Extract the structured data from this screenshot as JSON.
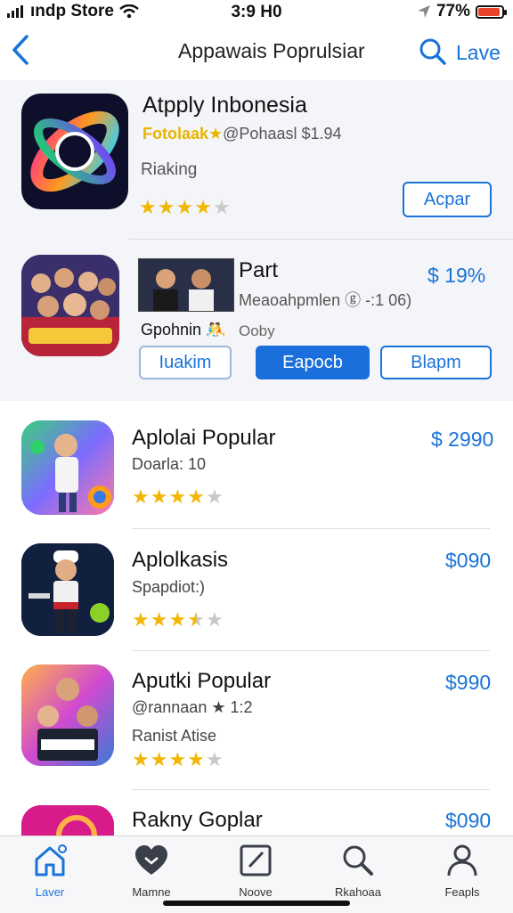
{
  "status_bar": {
    "carrier": "ındp Store",
    "time": "3:9 H0",
    "battery": "77%"
  },
  "nav": {
    "title": "Appawais  Poprulsiar",
    "action": "Lave"
  },
  "featured": [
    {
      "title": "Atpply Inbonesia",
      "subtitle_gold": "Fotolaak★",
      "subtitle": "@Pohaasl  $1.94",
      "rank_label": "Riaking",
      "rating": 4,
      "button": "Acpar"
    },
    {
      "title": "Part",
      "subtitle": "Meaoahpmlen ⓖ -:1 06)",
      "price": "$ 19%",
      "tag": "Gpohnin 🤼",
      "tag2": "Ooby",
      "buttons": [
        "Iuakim",
        "Eapocb",
        "Blapm"
      ]
    }
  ],
  "list": [
    {
      "title": "Aplolai Popular",
      "subtitle": "Doarla: 10",
      "price": "$ 2990",
      "rating": 4
    },
    {
      "title": "Aplolkasis",
      "subtitle": "Spapdiot:)",
      "price": "$090",
      "rating": 3.5
    },
    {
      "title": "Aputki Popular",
      "subtitle": "@rannaan ★ 1:2",
      "subtitle2": "Ranist Atise",
      "price": "$990",
      "rating": 4
    },
    {
      "title": "Rakny Goplar",
      "price": "$090"
    }
  ],
  "tabs": [
    {
      "label": "Laver",
      "icon": "home-icon",
      "active": true
    },
    {
      "label": "Mamne",
      "icon": "heart-icon",
      "active": false
    },
    {
      "label": "Noove",
      "icon": "edit-icon",
      "active": false
    },
    {
      "label": "Rkahoaa",
      "icon": "search-icon",
      "active": false
    },
    {
      "label": "Feapls",
      "icon": "person-icon",
      "active": false
    }
  ],
  "colors": {
    "accent": "#1a73d9",
    "star": "#f2b705",
    "battery": "#e8452c"
  }
}
